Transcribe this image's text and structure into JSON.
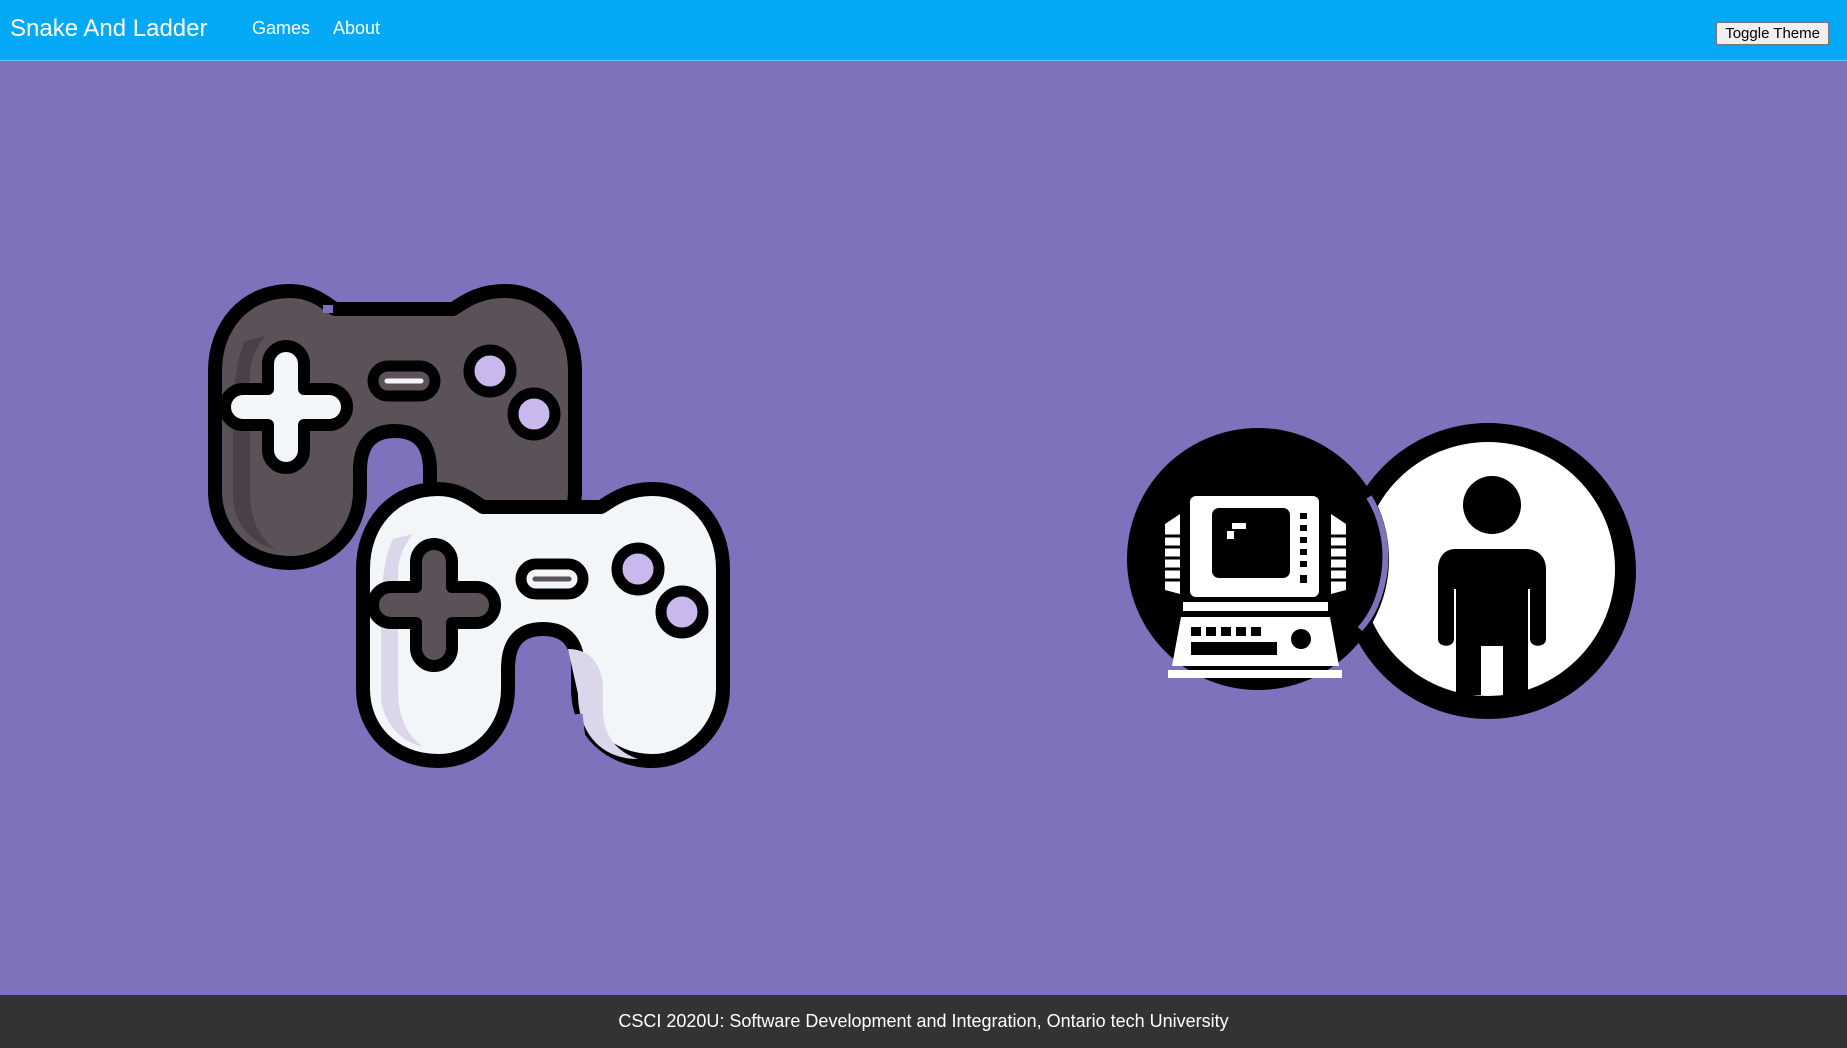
{
  "navbar": {
    "brand": "Snake And Ladder",
    "links": [
      "Games",
      "About"
    ],
    "toggle_theme_label": "Toggle Theme"
  },
  "main": {
    "cards": [
      {
        "icon": "game-controllers-icon"
      },
      {
        "icon": "computer-versus-player-icon"
      }
    ]
  },
  "footer": {
    "text": "CSCI 2020U: Software Development and Integration, Ontario tech University"
  },
  "colors": {
    "navbar": "#03a9f4",
    "background": "#7e72bc",
    "footer": "#333333",
    "controller_dark": "#5b5159",
    "controller_light": "#f3f6f8",
    "button_accent": "#c9b8ee"
  }
}
